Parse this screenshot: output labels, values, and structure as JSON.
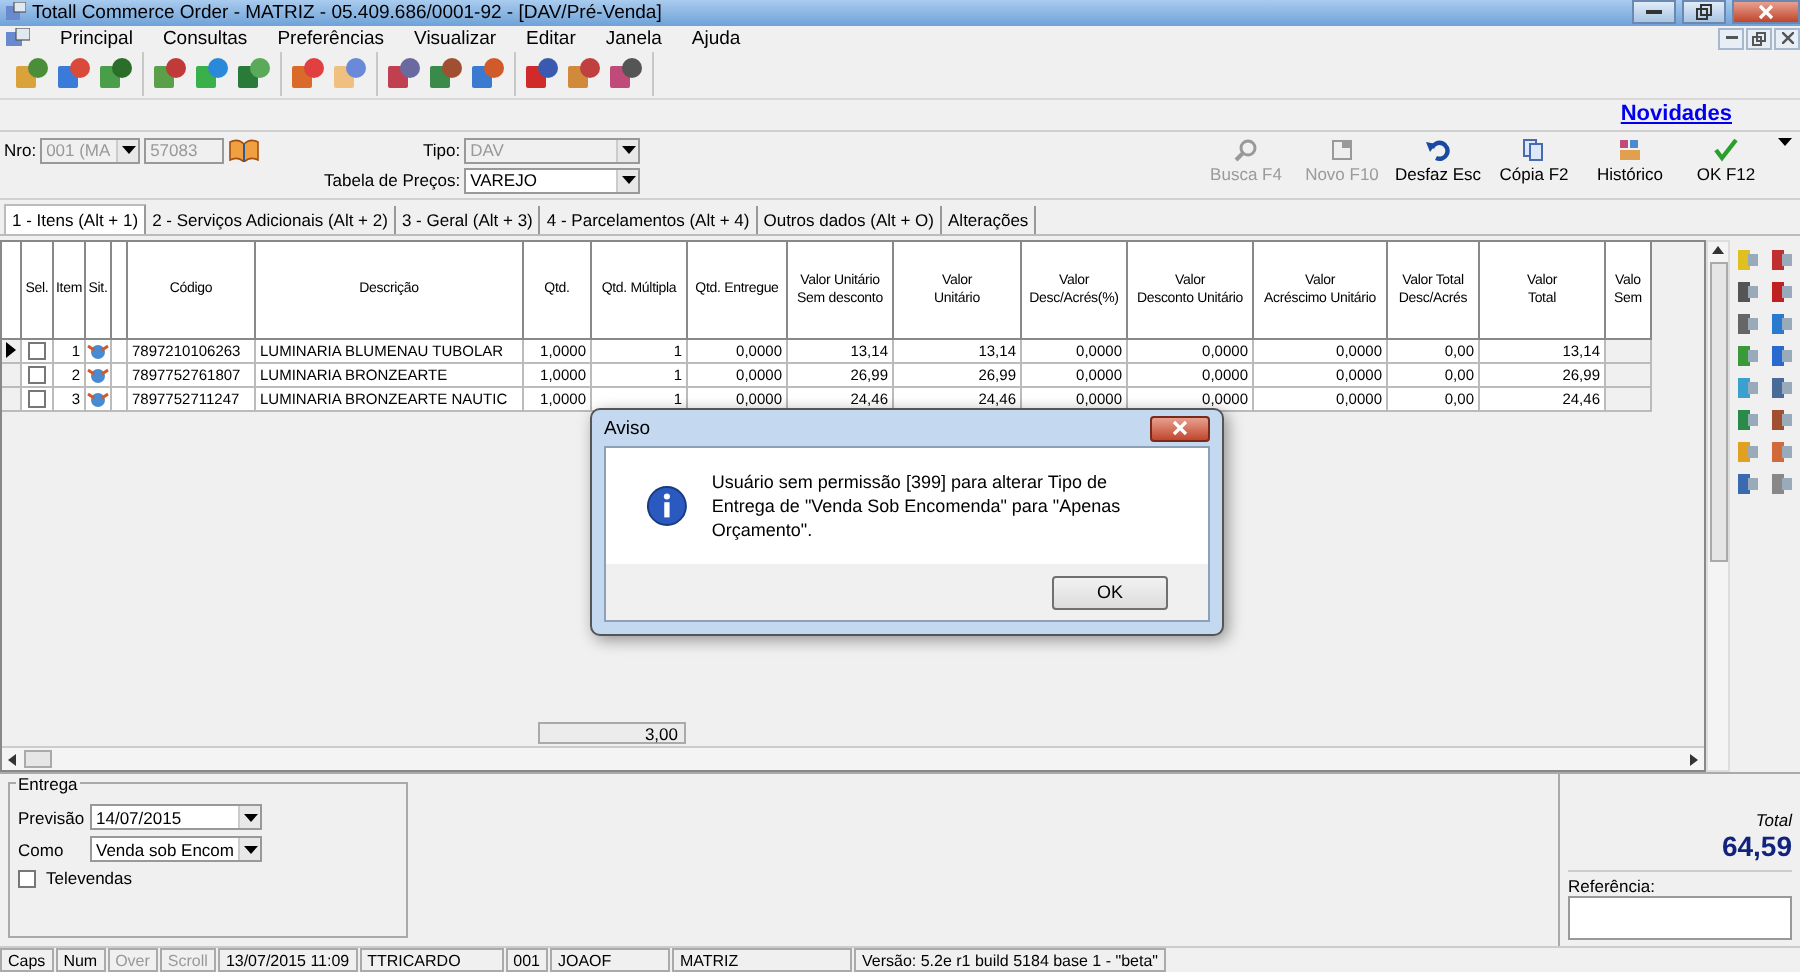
{
  "window": {
    "title": "Totall Commerce Order - MATRIZ  - 05.409.686/0001-92 - [DAV/Pré-Venda]"
  },
  "menu": [
    "Principal",
    "Consultas",
    "Preferências",
    "Visualizar",
    "Editar",
    "Janela",
    "Ajuda"
  ],
  "link": "Novidades",
  "form": {
    "nro_label": "Nro:",
    "nro": "001 (MA",
    "number": "57083",
    "tipo_label": "Tipo:",
    "tipo": "DAV",
    "tabela_label": "Tabela de Preços:",
    "tabela": "VAREJO"
  },
  "actions": [
    {
      "label": "Busca F4",
      "kind": "search",
      "disabled": true
    },
    {
      "label": "Novo F10",
      "kind": "new",
      "disabled": true
    },
    {
      "label": "Desfaz Esc",
      "kind": "undo",
      "disabled": false
    },
    {
      "label": "Cópia F2",
      "kind": "copy",
      "disabled": false
    },
    {
      "label": "Histórico",
      "kind": "history",
      "disabled": false
    },
    {
      "label": "OK F12",
      "kind": "ok",
      "disabled": false
    }
  ],
  "tabs": [
    {
      "label": "1 - Itens (Alt + 1)",
      "selected": true
    },
    {
      "label": "2 - Serviços Adicionais (Alt + 2)",
      "selected": false
    },
    {
      "label": "3 - Geral (Alt + 3)",
      "selected": false
    },
    {
      "label": "4 - Parcelamentos (Alt + 4)",
      "selected": false
    },
    {
      "label": "Outros dados (Alt + O)",
      "selected": false
    },
    {
      "label": "Alterações",
      "selected": false
    }
  ],
  "table": {
    "columns": [
      "Sel.",
      "Item",
      "Sit.",
      "",
      "Código",
      "Descrição",
      "Qtd.",
      "Qtd. Múltipla",
      "Qtd. Entregue",
      "Valor Unitário\nSem desconto",
      "Valor\nUnitário",
      "Valor\nDesc/Acrés(%)",
      "Valor\nDesconto Unitário",
      "Valor\nAcréscimo Unitário",
      "Valor Total\nDesc/Acrés",
      "Valor\nTotal",
      "Valo\nSem"
    ],
    "rows": [
      {
        "selected": true,
        "checked": false,
        "cells": [
          "",
          "1",
          "",
          "",
          "7897210106263",
          "LUMINARIA BLUMENAU TUBOLAR",
          "1,0000",
          "1",
          "0,0000",
          "13,14",
          "13,14",
          "0,0000",
          "0,0000",
          "0,0000",
          "0,00",
          "13,14",
          ""
        ]
      },
      {
        "selected": false,
        "checked": false,
        "cells": [
          "",
          "2",
          "",
          "",
          "7897752761807",
          "LUMINARIA BRONZEARTE",
          "1,0000",
          "1",
          "0,0000",
          "26,99",
          "26,99",
          "0,0000",
          "0,0000",
          "0,0000",
          "0,00",
          "26,99",
          ""
        ]
      },
      {
        "selected": false,
        "checked": false,
        "cells": [
          "",
          "3",
          "",
          "",
          "7897752711247",
          "LUMINARIA BRONZEARTE NAUTIC",
          "1,0000",
          "1",
          "0,0000",
          "24,46",
          "24,46",
          "0,0000",
          "0,0000",
          "0,0000",
          "0,00",
          "24,46",
          ""
        ]
      }
    ],
    "footer_qtd": "3,00"
  },
  "entrega": {
    "title": "Entrega",
    "previsao_label": "Previsão",
    "previsao": "14/07/2015",
    "como_label": "Como",
    "como": "Venda sob Encom",
    "televendas": {
      "label": "Televendas",
      "checked": false
    }
  },
  "summary": {
    "total_label": "Total",
    "total": "64,59",
    "referencia_label": "Referência:"
  },
  "status_bar": [
    {
      "text": "Caps",
      "disabled": false
    },
    {
      "text": "Num",
      "disabled": false
    },
    {
      "text": "Over",
      "disabled": true
    },
    {
      "text": "Scroll",
      "disabled": true
    },
    {
      "text": "13/07/2015 11:09",
      "disabled": false
    },
    {
      "text": "TTRICARDO",
      "disabled": false
    },
    {
      "text": "001",
      "disabled": false
    },
    {
      "text": "JOAOF",
      "disabled": false
    },
    {
      "text": "MATRIZ",
      "disabled": false
    },
    {
      "text": "Versão: 5.2e r1 build 5184 base 1 - \"beta\"",
      "disabled": false
    }
  ],
  "dialog": {
    "title": "Aviso",
    "message": "Usuário sem permissão [399] para alterar Tipo de Entrega de \"Venda Sob Encomenda\" para \"Apenas Orçamento\".",
    "button": "OK"
  }
}
